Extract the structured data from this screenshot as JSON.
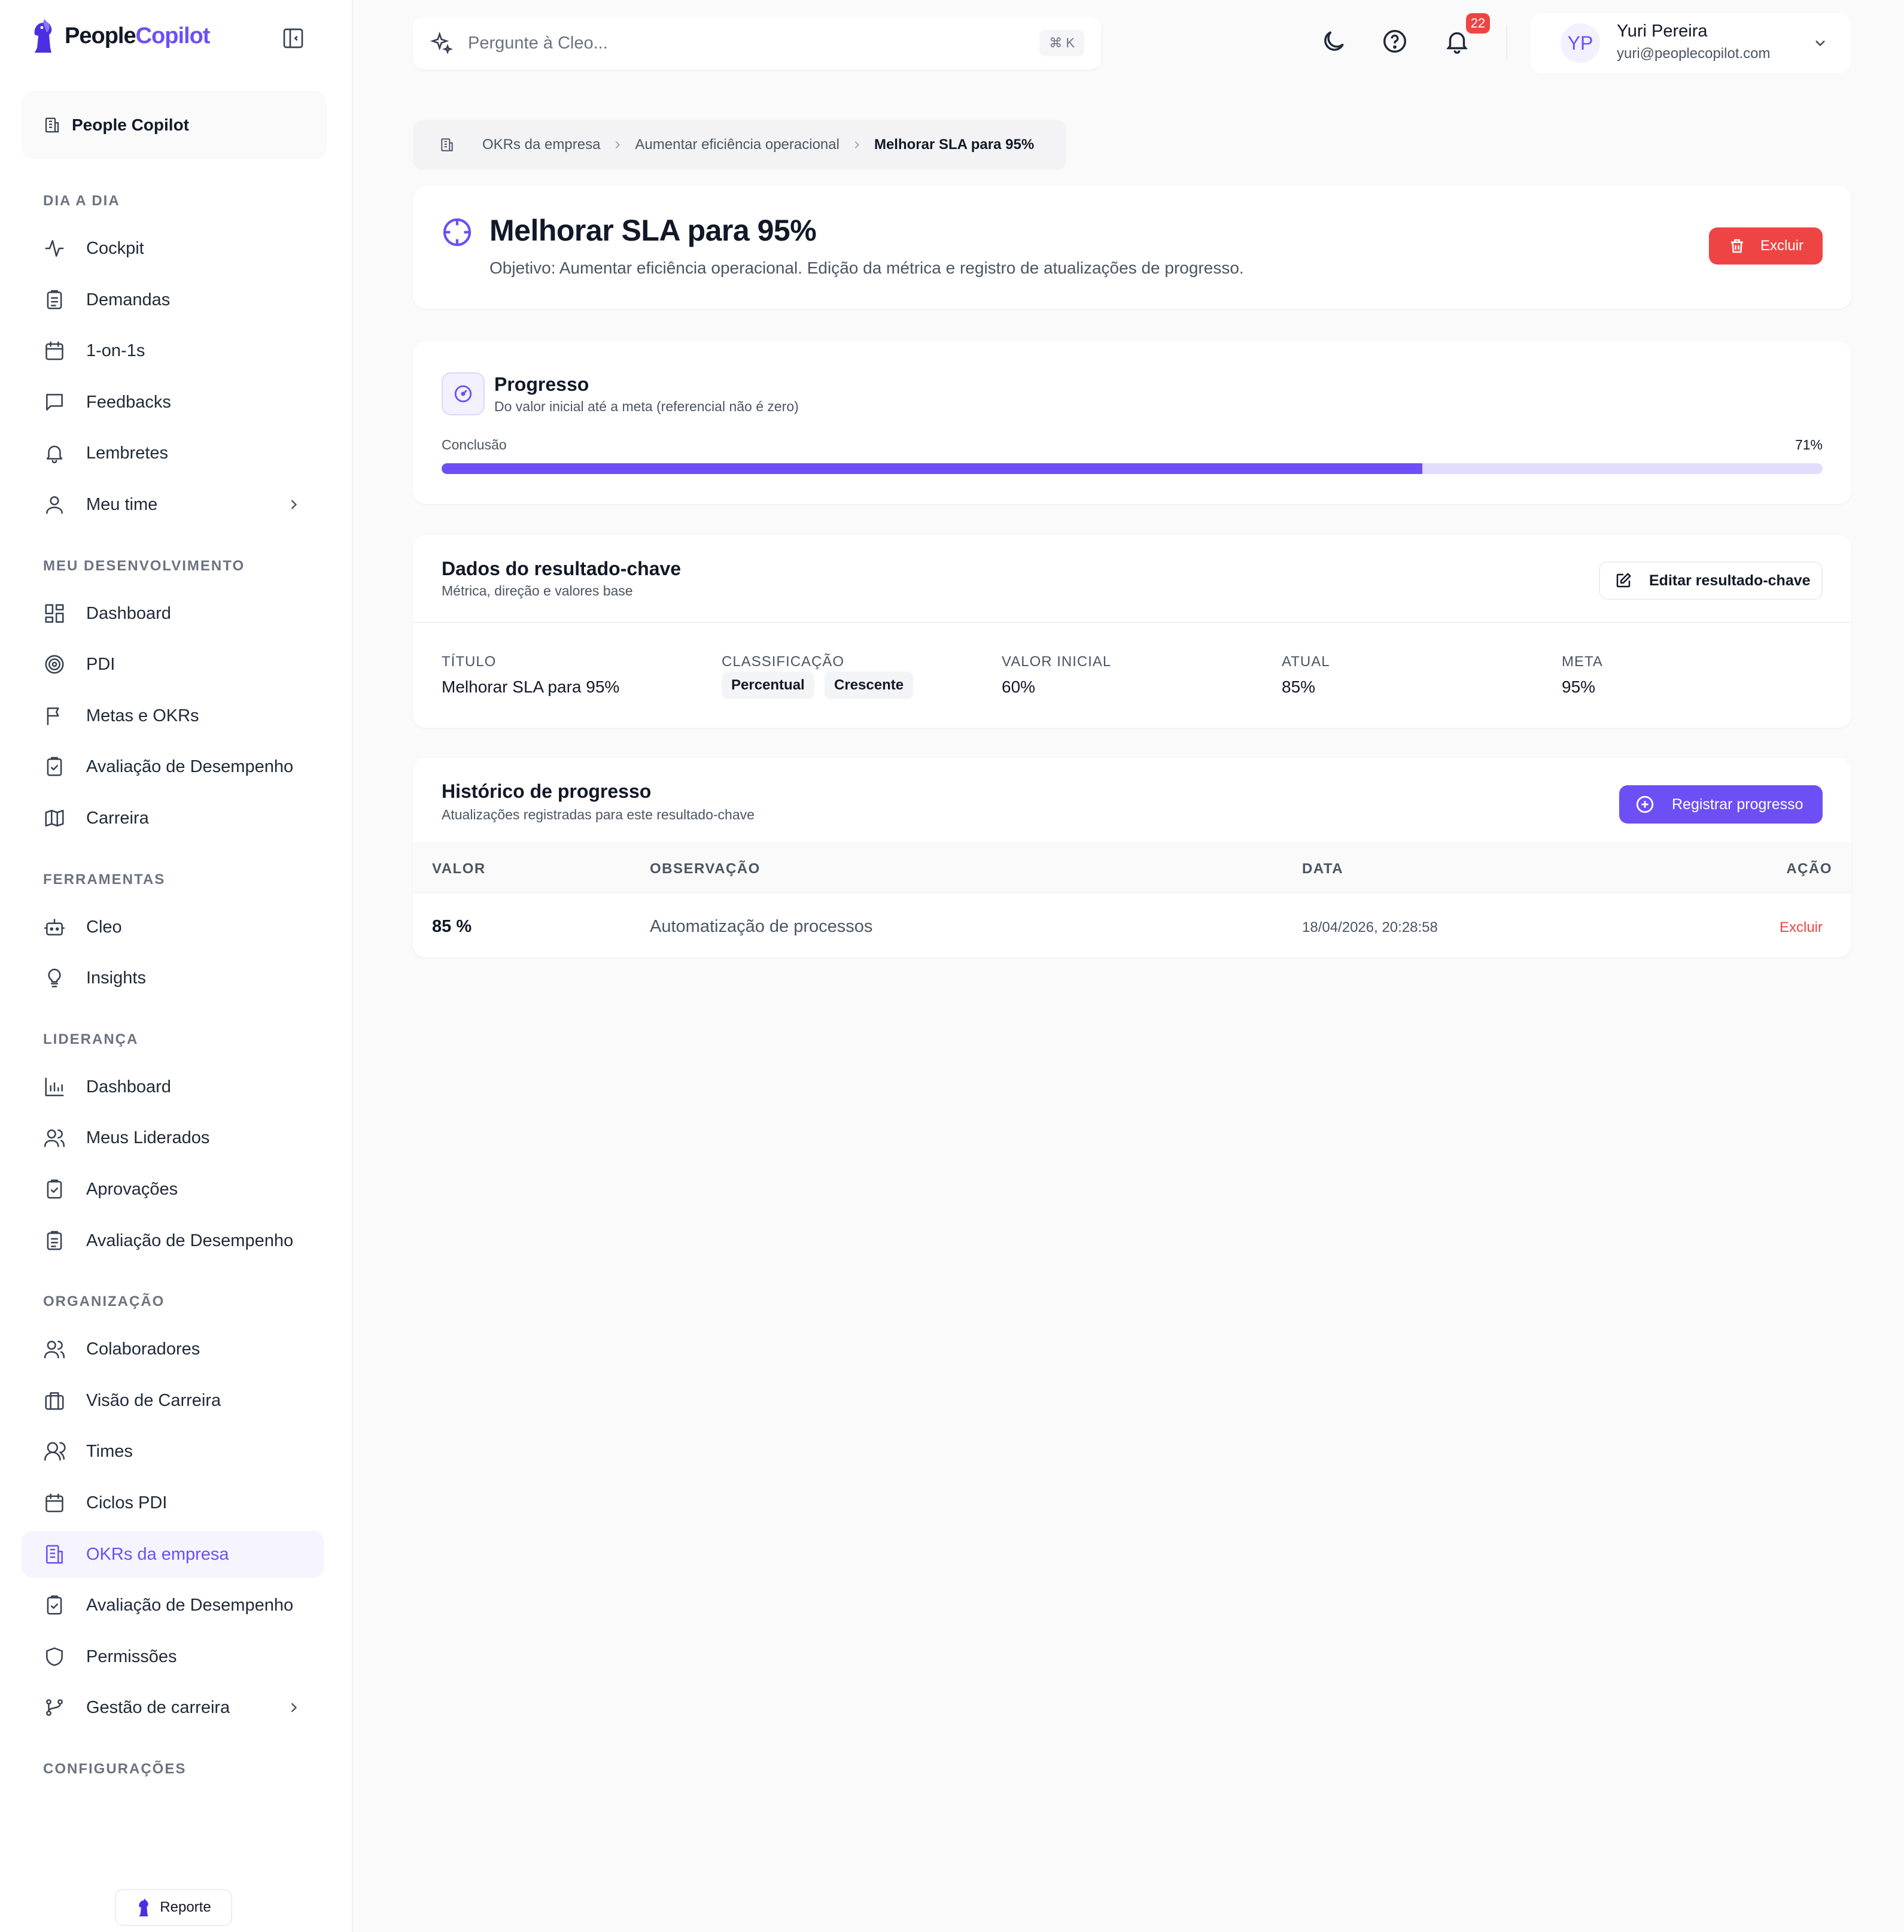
{
  "brand": {
    "name_part1": "People",
    "name_part2": "Copilot"
  },
  "workspace": {
    "name": "People Copilot"
  },
  "sidebar": {
    "sections": [
      {
        "title": "DIA A DIA",
        "items": [
          {
            "label": "Cockpit",
            "icon": "activity-icon"
          },
          {
            "label": "Demandas",
            "icon": "clipboard-list-icon"
          },
          {
            "label": "1-on-1s",
            "icon": "calendar-icon"
          },
          {
            "label": "Feedbacks",
            "icon": "message-square-icon"
          },
          {
            "label": "Lembretes",
            "icon": "bell-icon"
          },
          {
            "label": "Meu time",
            "icon": "user-icon",
            "has_submenu": true
          }
        ]
      },
      {
        "title": "MEU DESENVOLVIMENTO",
        "items": [
          {
            "label": "Dashboard",
            "icon": "layout-dashboard-icon"
          },
          {
            "label": "PDI",
            "icon": "target-icon"
          },
          {
            "label": "Metas e OKRs",
            "icon": "flag-icon"
          },
          {
            "label": "Avaliação de Desempenho",
            "icon": "clipboard-check-icon"
          },
          {
            "label": "Carreira",
            "icon": "map-icon"
          }
        ]
      },
      {
        "title": "FERRAMENTAS",
        "items": [
          {
            "label": "Cleo",
            "icon": "bot-icon"
          },
          {
            "label": "Insights",
            "icon": "lightbulb-icon"
          }
        ]
      },
      {
        "title": "LIDERANÇA",
        "items": [
          {
            "label": "Dashboard",
            "icon": "bar-chart-icon"
          },
          {
            "label": "Meus Liderados",
            "icon": "users-icon"
          },
          {
            "label": "Aprovações",
            "icon": "clipboard-check-icon"
          },
          {
            "label": "Avaliação de Desempenho",
            "icon": "clipboard-list-icon"
          }
        ]
      },
      {
        "title": "ORGANIZAÇÃO",
        "items": [
          {
            "label": "Colaboradores",
            "icon": "users-icon"
          },
          {
            "label": "Visão de Carreira",
            "icon": "briefcase-icon"
          },
          {
            "label": "Times",
            "icon": "users-round-icon"
          },
          {
            "label": "Ciclos PDI",
            "icon": "calendar-icon"
          },
          {
            "label": "OKRs da empresa",
            "icon": "building-icon",
            "active": true
          },
          {
            "label": "Avaliação de Desempenho",
            "icon": "clipboard-check-icon"
          },
          {
            "label": "Permissões",
            "icon": "shield-icon"
          },
          {
            "label": "Gestão de carreira",
            "icon": "git-branch-icon",
            "has_submenu": true
          }
        ]
      },
      {
        "title": "CONFIGURAÇÕES",
        "items": []
      }
    ],
    "report_label": "Reporte"
  },
  "header": {
    "search_placeholder": "Pergunte à Cleo...",
    "shortcut": "⌘ K",
    "notification_count": "22",
    "user": {
      "initials": "YP",
      "name": "Yuri Pereira",
      "email": "yuri@peoplecopilot.com"
    }
  },
  "breadcrumb": [
    "OKRs da empresa",
    "Aumentar eficiência operacional",
    "Melhorar SLA para 95%"
  ],
  "title_card": {
    "title": "Melhorar SLA para 95%",
    "subtitle": "Objetivo: Aumentar eficiência operacional. Edição da métrica e registro de atualizações de progresso.",
    "delete_label": "Excluir"
  },
  "progress": {
    "title": "Progresso",
    "subtitle": "Do valor inicial até a meta (referencial não é zero)",
    "label": "Conclusão",
    "percent_text": "71%",
    "fraction": 0.71
  },
  "kr_data": {
    "title": "Dados do resultado-chave",
    "subtitle": "Métrica, direção e valores base",
    "edit_label": "Editar resultado-chave",
    "fields": {
      "title_label": "TÍTULO",
      "title_value": "Melhorar SLA para 95%",
      "class_label": "CLASSIFICAÇÃO",
      "class_pills": [
        "Percentual",
        "Crescente"
      ],
      "initial_label": "VALOR INICIAL",
      "initial_value": "60%",
      "current_label": "ATUAL",
      "current_value": "85%",
      "goal_label": "META",
      "goal_value": "95%"
    }
  },
  "history": {
    "title": "Histórico de progresso",
    "subtitle": "Atualizações registradas para este resultado-chave",
    "register_label": "Registrar progresso",
    "columns": [
      "VALOR",
      "OBSERVAÇÃO",
      "DATA",
      "AÇÃO"
    ],
    "rows": [
      {
        "value": "85 %",
        "note": "Automatização de processos",
        "date": "18/04/2026, 20:28:58",
        "action": "Excluir"
      }
    ]
  },
  "colors": {
    "accent": "#6d4ff5",
    "danger": "#ef4444"
  }
}
